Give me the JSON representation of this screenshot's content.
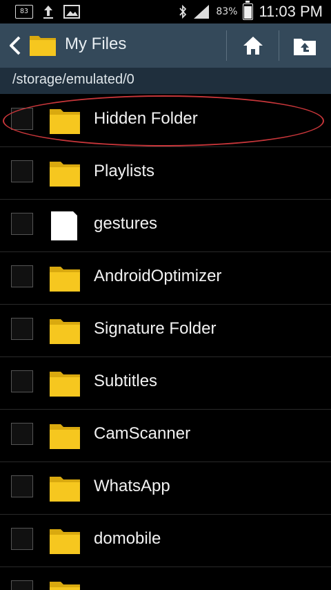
{
  "status_bar": {
    "notification_count": "83",
    "battery_percent": "83%",
    "time": "11:03 PM",
    "icons": [
      "notification-box-icon",
      "upload-icon",
      "image-icon",
      "bluetooth-icon",
      "signal-icon",
      "battery-icon"
    ]
  },
  "action_bar": {
    "title": "My Files",
    "icons": [
      "back-icon",
      "folder-icon",
      "home-icon",
      "folder-up-icon"
    ]
  },
  "path_bar": {
    "path": "/storage/emulated/0"
  },
  "files": [
    {
      "name": "Hidden Folder",
      "icon": "folder-icon"
    },
    {
      "name": "Playlists",
      "icon": "folder-icon"
    },
    {
      "name": "gestures",
      "icon": "file-icon"
    },
    {
      "name": "AndroidOptimizer",
      "icon": "folder-icon"
    },
    {
      "name": "Signature Folder",
      "icon": "folder-icon"
    },
    {
      "name": "Subtitles",
      "icon": "folder-icon"
    },
    {
      "name": "CamScanner",
      "icon": "folder-icon"
    },
    {
      "name": "WhatsApp",
      "icon": "folder-icon"
    },
    {
      "name": "domobile",
      "icon": "folder-icon"
    }
  ],
  "colors": {
    "action_bar": "#34495a",
    "path_bar": "#1f2f3d",
    "folder": "#f6c71f",
    "highlight_ring": "#c8363a"
  }
}
